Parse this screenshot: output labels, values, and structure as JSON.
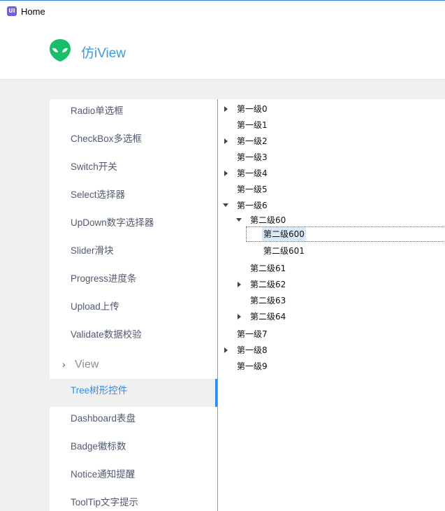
{
  "window": {
    "title": "Home",
    "icon": "ui-app-icon"
  },
  "header": {
    "brand": "仿iView",
    "logo": "alien-logo-icon"
  },
  "sidebar": {
    "items_top": [
      {
        "label": "Radio单选框"
      },
      {
        "label": "CheckBox多选框"
      },
      {
        "label": "Switch开关"
      },
      {
        "label": "Select选择器"
      },
      {
        "label": "UpDown数字选择器"
      },
      {
        "label": "Slider滑块"
      },
      {
        "label": "Progress进度条"
      },
      {
        "label": "Upload上传"
      },
      {
        "label": "Validate数据校验"
      }
    ],
    "group": {
      "label": "View",
      "icon": "chevron-right-icon"
    },
    "items_bottom": [
      {
        "label": "Tree树形控件",
        "active": true
      },
      {
        "label": "Dashboard表盘"
      },
      {
        "label": "Badge徽标数"
      },
      {
        "label": "Notice通知提醒"
      },
      {
        "label": "ToolTip文字提示"
      }
    ],
    "accent": "#2d8cf0"
  },
  "tree": {
    "nodes": [
      {
        "label": "第一级0",
        "level": 1,
        "state": "collapsed"
      },
      {
        "label": "第一级1",
        "level": 1,
        "state": "leaf"
      },
      {
        "label": "第一级2",
        "level": 1,
        "state": "collapsed"
      },
      {
        "label": "第一级3",
        "level": 1,
        "state": "leaf"
      },
      {
        "label": "第一级4",
        "level": 1,
        "state": "collapsed"
      },
      {
        "label": "第一级5",
        "level": 1,
        "state": "leaf"
      },
      {
        "label": "第一级6",
        "level": 1,
        "state": "expanded"
      },
      {
        "label": "第二级60",
        "level": 2,
        "state": "expanded"
      },
      {
        "label": "第二级600",
        "level": 3,
        "state": "leaf",
        "selected": true
      },
      {
        "label": "第二级601",
        "level": 3,
        "state": "leaf"
      },
      {
        "label": "第二级61",
        "level": 2,
        "state": "leaf"
      },
      {
        "label": "第二级62",
        "level": 2,
        "state": "collapsed"
      },
      {
        "label": "第二级63",
        "level": 2,
        "state": "leaf"
      },
      {
        "label": "第二级64",
        "level": 2,
        "state": "collapsed"
      },
      {
        "label": "第一级7",
        "level": 1,
        "state": "leaf"
      },
      {
        "label": "第一级8",
        "level": 1,
        "state": "collapsed"
      },
      {
        "label": "第一级9",
        "level": 1,
        "state": "leaf"
      }
    ],
    "selected_color": "#d8e9fb"
  }
}
